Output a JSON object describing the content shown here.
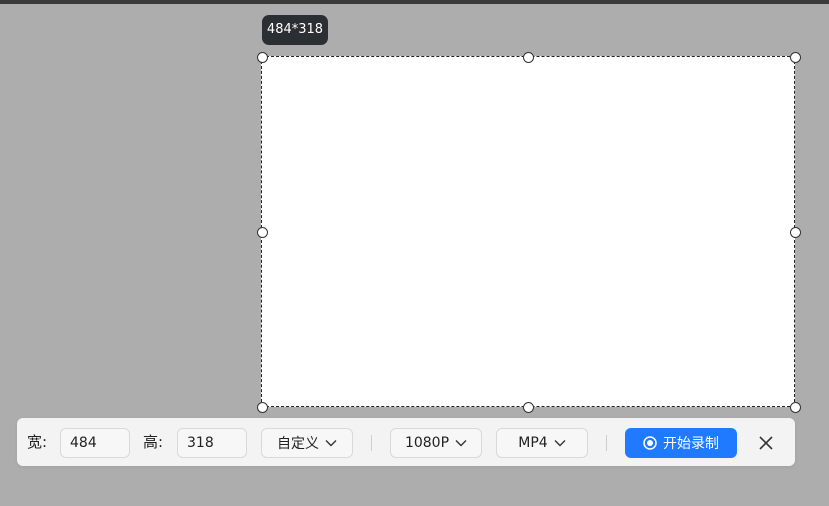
{
  "tooltip": {
    "size_text": "484*318"
  },
  "toolbar": {
    "width_label": "宽:",
    "width_value": "484",
    "height_label": "高:",
    "height_value": "318",
    "ratio_select": "自定义",
    "resolution_select": "1080P",
    "format_select": "MP4",
    "record_label": "开始录制"
  },
  "icons": {
    "dropdown": "chevron-down-icon",
    "record": "record-icon",
    "close": "close-icon"
  },
  "colors": {
    "accent": "#1f7aff",
    "backdrop": "#adadad",
    "tooltip_bg": "#2b2e33"
  }
}
